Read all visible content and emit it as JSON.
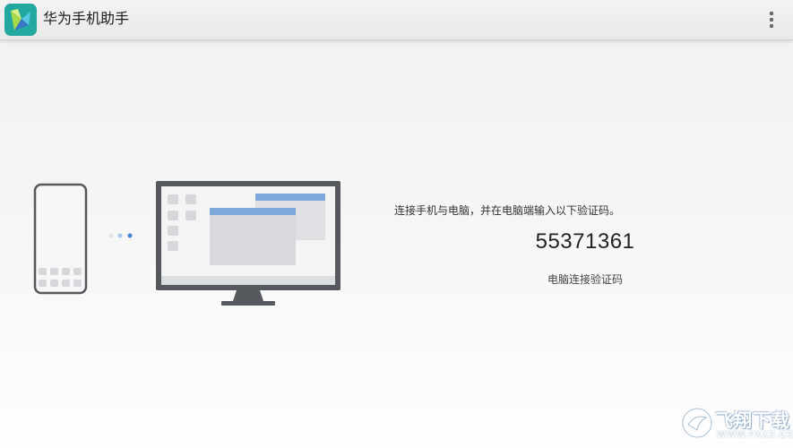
{
  "app": {
    "title": "华为手机助手",
    "icon": "huawei-hisuite-icon",
    "menu_icon": "overflow-menu-icon"
  },
  "connection": {
    "instruction": "连接手机与电脑，并在电脑端输入以下验证码。",
    "code": "55371361",
    "code_label": "电脑连接验证码"
  },
  "illustration": {
    "phone_icon": "phone-icon",
    "dots_icon": "connecting-dots-icon",
    "monitor_icon": "computer-monitor-icon"
  },
  "watermark": {
    "title": "飞翔下载",
    "url": "WWW.FXXZ.COM"
  },
  "colors": {
    "accent_blue": "#3b84d6",
    "window_bar_blue": "#7ea8dc",
    "device_gray": "#55585c",
    "screen_fill": "#f4f4f5",
    "tile_gray": "#d6d7da",
    "app_icon_teal": "#1f9b94"
  }
}
